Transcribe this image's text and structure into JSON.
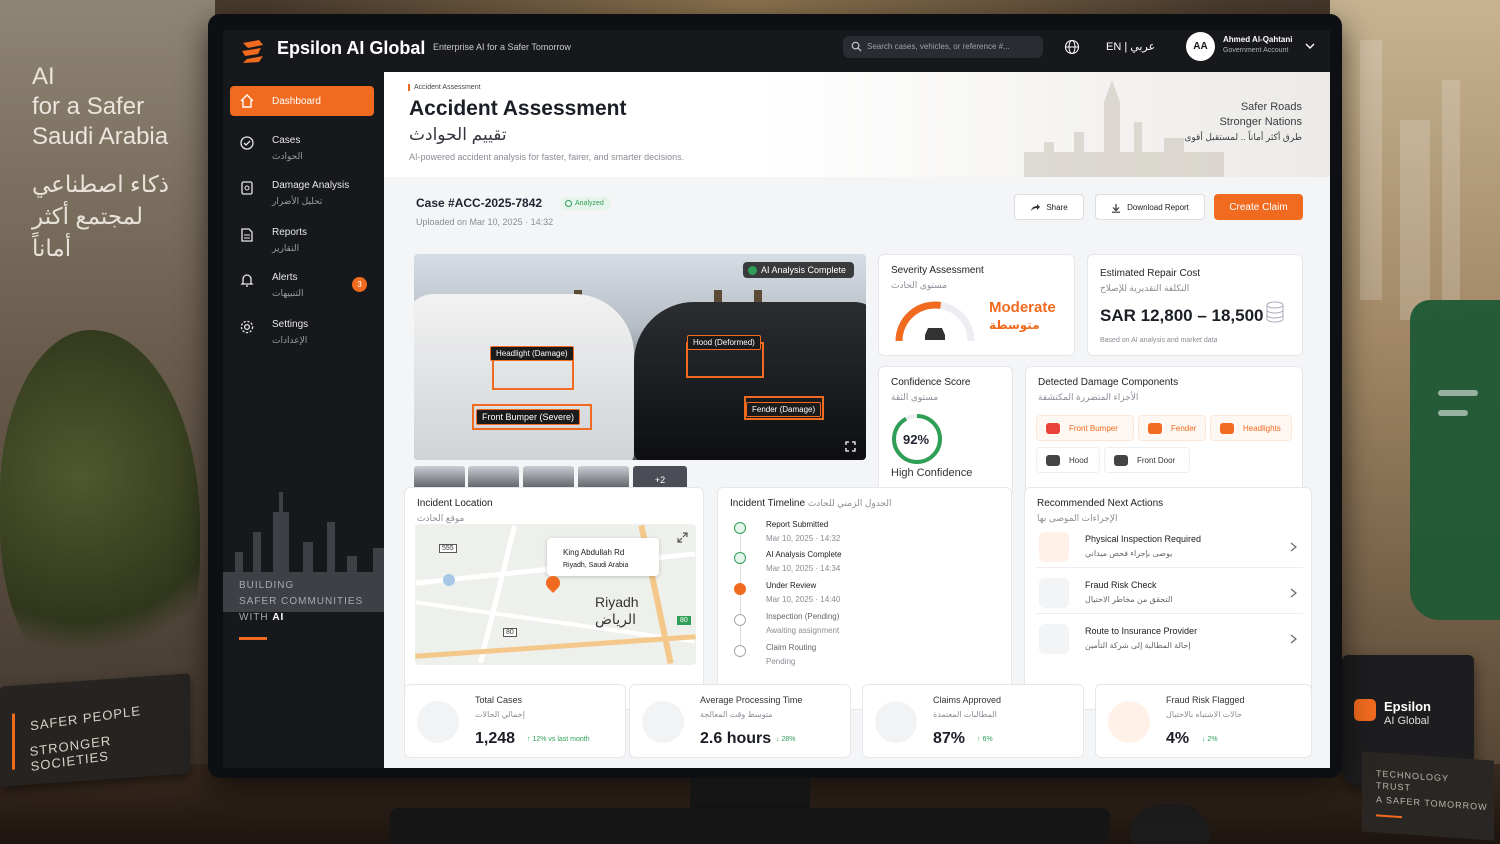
{
  "backdrop": {
    "tagline_en": [
      "AI",
      "for a Safer",
      "Saudi Arabia"
    ],
    "tagline_ar": [
      "ذكاء اصطناعي",
      "لمجتمع أكثر أماناً"
    ],
    "book_lines": [
      "SAFER PEOPLE",
      "STRONGER SOCIETIES"
    ],
    "mug_brand": "Epsilon",
    "mug_brand_sub": "AI Global",
    "card_lines": [
      "TECHNOLOGY",
      "TRUST",
      "A SAFER TOMORROW"
    ]
  },
  "topbar": {
    "brand": "Epsilon AI Global",
    "tagline": "Enterprise AI for a Safer Tomorrow",
    "search_placeholder": "Search cases, vehicles, or reference #...",
    "lang": "EN | عربي",
    "avatar_initials": "AA",
    "user_name": "Ahmed Al-Qahtani",
    "user_role": "Government Account"
  },
  "sidebar": {
    "items": [
      {
        "label": "Dashboard",
        "label_ar": "",
        "icon": "home-icon"
      },
      {
        "label": "Cases",
        "label_ar": "الحوادث",
        "icon": "cases-icon"
      },
      {
        "label": "Damage Analysis",
        "label_ar": "تحليل الأضرار",
        "icon": "damage-icon"
      },
      {
        "label": "Reports",
        "label_ar": "التقارير",
        "icon": "report-icon"
      },
      {
        "label": "Alerts",
        "label_ar": "التنبيهات",
        "icon": "bell-icon",
        "badge": "3"
      },
      {
        "label": "Settings",
        "label_ar": "الإعدادات",
        "icon": "gear-icon"
      }
    ],
    "footer_lines": [
      "BUILDING",
      "SAFER COMMUNITIES",
      "WITH"
    ],
    "footer_accent": "AI"
  },
  "hero": {
    "breadcrumb": "Accident Assessment",
    "title": "Accident Assessment",
    "title_ar": "تقييم الحوادث",
    "subtitle": "AI-powered accident analysis for faster, fairer, and smarter decisions.",
    "right_line1": "Safer Roads",
    "right_line2": "Stronger Nations",
    "right_line3": "طرق أكثر أماناً .. لمستقبل أقوى"
  },
  "case": {
    "id": "Case #ACC-2025-7842",
    "status": "Analyzed",
    "uploaded": "Uploaded on Mar 10, 2025",
    "uploaded_time": "14:32",
    "share_label": "Share",
    "download_label": "Download Report",
    "create_label": "Create Claim",
    "ai_chip": "AI Analysis Complete",
    "damage_labels": [
      "Headlight (Damage)",
      "Hood (Deformed)",
      "Front Bumper (Severe)",
      "Fender (Damage)"
    ],
    "more_thumbs": "+2"
  },
  "severity": {
    "title": "Severity Assessment",
    "title_ar": "مستوى الحادث",
    "value": "Moderate",
    "value_ar": "متوسطة",
    "level": 0.55
  },
  "cost": {
    "title": "Estimated Repair Cost",
    "title_ar": "التكلفة التقديرية للإصلاح",
    "value": "SAR 12,800 – 18,500",
    "note": "Based on AI analysis and market data"
  },
  "confidence": {
    "title": "Confidence Score",
    "title_ar": "مستوى الثقة",
    "value": "92%",
    "fraction": 0.92,
    "label": "High Confidence"
  },
  "components": {
    "title": "Detected Damage Components",
    "title_ar": "الأجزاء المتضررة المكتشفة",
    "items": [
      {
        "label": "Front Bumper",
        "damaged": true
      },
      {
        "label": "Fender",
        "damaged": true
      },
      {
        "label": "Headlights",
        "damaged": true
      },
      {
        "label": "Hood",
        "damaged": false
      },
      {
        "label": "Front Door",
        "damaged": false
      }
    ]
  },
  "location": {
    "title": "Incident Location",
    "title_ar": "موقع الحادث",
    "street": "King Abdullah Rd",
    "area": "Riyadh, Saudi Arabia",
    "city": "Riyadh",
    "city_ar": "الرياض",
    "road_shields": [
      "555",
      "80",
      "80"
    ]
  },
  "timeline": {
    "title": "Incident Timeline",
    "title_ar": "الجدول الزمني للحادث",
    "items": [
      {
        "label": "Report Submitted",
        "sub": "Mar 10, 2025 · 14:32",
        "state": "done"
      },
      {
        "label": "AI Analysis Complete",
        "sub": "Mar 10, 2025 · 14:34",
        "state": "done"
      },
      {
        "label": "Under Review",
        "sub": "Mar 10, 2025 · 14:40",
        "state": "current"
      },
      {
        "label": "Inspection (Pending)",
        "sub": "Awaiting assignment",
        "state": "pending"
      },
      {
        "label": "Claim Routing",
        "sub": "Pending",
        "state": "pending"
      }
    ]
  },
  "actions": {
    "title": "Recommended Next Actions",
    "title_ar": "الإجراءات الموصى بها",
    "items": [
      {
        "label": "Physical Inspection Required",
        "label_ar": "يوصى بإجراء فحص ميداني",
        "icon": "inspection-icon"
      },
      {
        "label": "Fraud Risk Check",
        "label_ar": "التحقق من مخاطر الاحتيال",
        "icon": "shield-check-icon"
      },
      {
        "label": "Route to Insurance Provider",
        "label_ar": "إحالة المطالبة إلى شركة التأمين",
        "icon": "route-arrow-icon"
      }
    ]
  },
  "kpis": [
    {
      "title": "Total Cases",
      "title_ar": "إجمالي الحالات",
      "value": "1,248",
      "delta": "↑ 12% vs last month"
    },
    {
      "title": "Average Processing Time",
      "title_ar": "متوسط وقت المعالجة",
      "value": "2.6 hours",
      "delta": "↓ 28%"
    },
    {
      "title": "Claims Approved",
      "title_ar": "المطالبات المعتمدة",
      "value": "87%",
      "delta": "↑ 6%"
    },
    {
      "title": "Fraud Risk Flagged",
      "title_ar": "حالات الاشتباه بالاحتيال",
      "value": "4%",
      "delta": "↓ 2%"
    }
  ],
  "colors": {
    "accent": "#f06a1f",
    "sidebar": "#17181c",
    "success": "#2f9e57"
  }
}
